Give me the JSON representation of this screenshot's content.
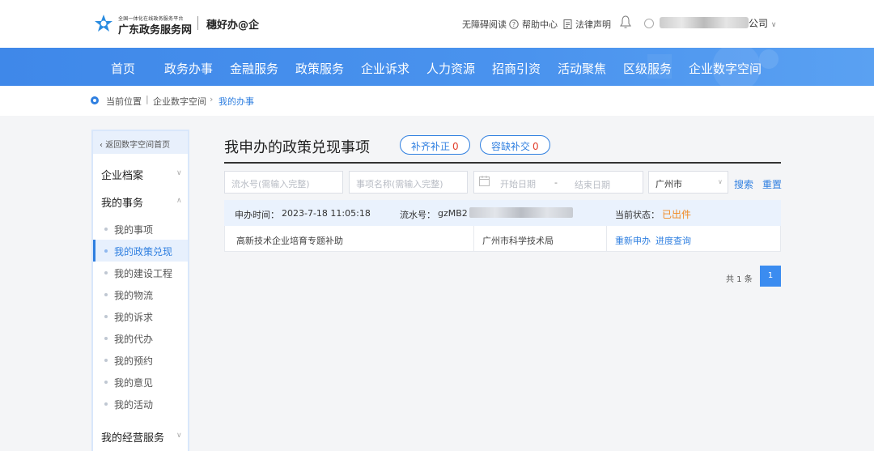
{
  "header": {
    "platform_small": "全国一体化在线政务服务平台",
    "platform_name": "广东政务服务网",
    "brand": "穗好办@企",
    "accessibility": "无障碍阅读",
    "help": "帮助中心",
    "legal": "法律声明",
    "company_suffix": "公司"
  },
  "nav": {
    "items": [
      "首页",
      "政务办事",
      "金融服务",
      "政策服务",
      "企业诉求",
      "人力资源",
      "招商引资",
      "活动聚焦",
      "区级服务",
      "企业数字空间"
    ]
  },
  "breadcrumb": {
    "label": "当前位置",
    "items": [
      "企业数字空间",
      "我的办事"
    ]
  },
  "sidebar": {
    "back": "返回数字空间首页",
    "groups": [
      "企业档案",
      "我的事务",
      "我的经营服务"
    ],
    "items": [
      "我的事项",
      "我的政策兑现",
      "我的建设工程",
      "我的物流",
      "我的诉求",
      "我的代办",
      "我的预约",
      "我的意见",
      "我的活动"
    ],
    "active_index": 1
  },
  "main": {
    "title": "我申办的政策兑现事项",
    "pills": [
      {
        "label": "补齐补正",
        "count": "0"
      },
      {
        "label": "容缺补交",
        "count": "0"
      }
    ],
    "filters": {
      "serial_placeholder": "流水号(需输入完整)",
      "item_placeholder": "事项名称(需输入完整)",
      "start_placeholder": "开始日期",
      "range_sep": "-",
      "end_placeholder": "结束日期",
      "city_value": "广州市",
      "search": "搜索",
      "reset": "重置"
    },
    "record": {
      "time_label": "申办时间：",
      "time_value": "2023-7-18 11:05:18",
      "serial_label": "流水号：",
      "serial_value": "gzMB2",
      "status_label": "当前状态：",
      "status_value": "已出件",
      "status_color": "#f08a24",
      "item_name": "高新技术企业培育专题补助",
      "department": "广州市科学技术局",
      "actions": [
        "重新申办",
        "进度查询"
      ]
    },
    "pagination": {
      "total": "共 1 条",
      "current_page": "1"
    }
  },
  "colors": {
    "accent": "#2f7fe0",
    "nav_bg": "#4a93ee"
  }
}
